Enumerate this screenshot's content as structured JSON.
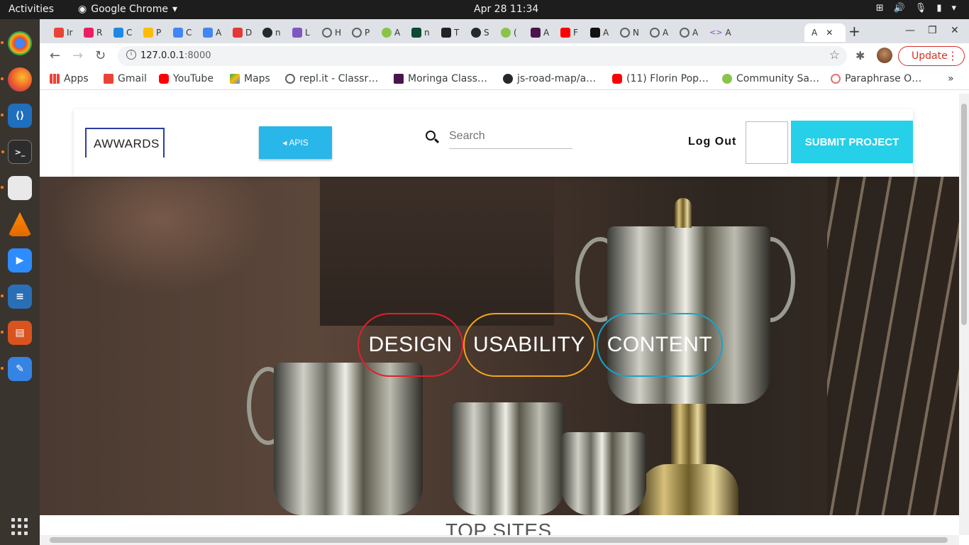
{
  "os": {
    "activities": "Activities",
    "app_name": "Google Chrome",
    "clock": "Apr 28  11:34"
  },
  "browser": {
    "tabs": [
      "Ir",
      "R",
      "C",
      "P",
      "C",
      "A",
      "D",
      "n",
      "L",
      "H",
      "P",
      "A",
      "n",
      "T",
      "S",
      "(",
      "A",
      "F",
      "A",
      "N",
      "A",
      "A"
    ],
    "address": {
      "host": "127.0.0.1",
      "port": ":8000"
    },
    "update_label": "Update",
    "bookmarks": [
      {
        "label": "Apps",
        "icon": "apps-grid-icon"
      },
      {
        "label": "Gmail",
        "icon": "gmail-icon"
      },
      {
        "label": "YouTube",
        "icon": "youtube-icon"
      },
      {
        "label": "Maps",
        "icon": "maps-icon"
      },
      {
        "label": "repl.it - Classr…",
        "icon": "replit-icon"
      },
      {
        "label": "Moringa Class…",
        "icon": "slack-icon"
      },
      {
        "label": "js-road-map/a…",
        "icon": "github-icon"
      },
      {
        "label": "(11) Florin Pop…",
        "icon": "youtube-icon"
      },
      {
        "label": "Community Sa…",
        "icon": "palm-icon"
      },
      {
        "label": "Paraphrase O…",
        "icon": "paraphrase-icon"
      }
    ],
    "bookmarks_overflow": "»"
  },
  "site": {
    "brand": "AWWARDS",
    "apis_label": "APIS",
    "search_placeholder": "Search",
    "logout_label": "Log Out",
    "submit_label": "SUBMIT PROJECT",
    "pills": [
      "DESIGN",
      "USABILITY",
      "CONTENT"
    ],
    "section_heading": "TOP SITES"
  },
  "colors": {
    "accent_blue": "#29b6e8",
    "submit_cyan": "#26d0e8",
    "design_red": "#e0202e",
    "usability_orange": "#f5a41a",
    "content_blue": "#19a3c9",
    "update_red": "#d93025"
  }
}
